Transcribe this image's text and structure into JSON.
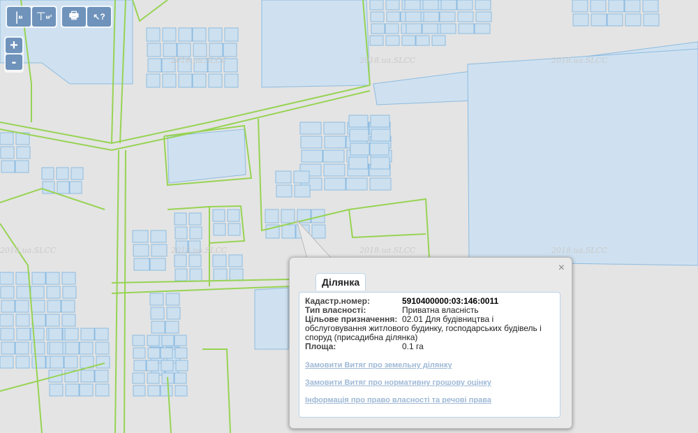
{
  "toolbar": {
    "buttons": [
      {
        "name": "measure-length-button",
        "icon": "ruler-line-icon",
        "label": "м"
      },
      {
        "name": "measure-area-button",
        "icon": "ruler-area-icon",
        "label": "м²"
      },
      {
        "name": "print-button",
        "icon": "printer-icon",
        "label": ""
      },
      {
        "name": "identify-button",
        "icon": "cursor-question-icon",
        "label": "?"
      }
    ]
  },
  "zoom": {
    "in": "+",
    "out": "-"
  },
  "watermark": "2018.ua.SLCC",
  "popup": {
    "close": "×",
    "tab": "Ділянка",
    "fields": [
      {
        "label": "Кадастр.номер:",
        "value": "5910400000:03:146:0011"
      },
      {
        "label": "Тип власності:",
        "value": "Приватна власність"
      },
      {
        "label": "Цільове призначення:",
        "value": "02.01 Для будівництва і обслуговування житлового будинку, господарських будівель і споруд (присадибна ділянка)"
      },
      {
        "label": "Площа:",
        "value": "0.1 га"
      }
    ],
    "links": [
      "Замовити Витяг про земельну ділянку",
      "Замовити Витяг про нормативну грошову оцінку",
      "Інформація про право власності та речові права"
    ]
  },
  "colors": {
    "parcel": "#cde0ef",
    "road": "#97d353",
    "button": "#6f93bb"
  }
}
